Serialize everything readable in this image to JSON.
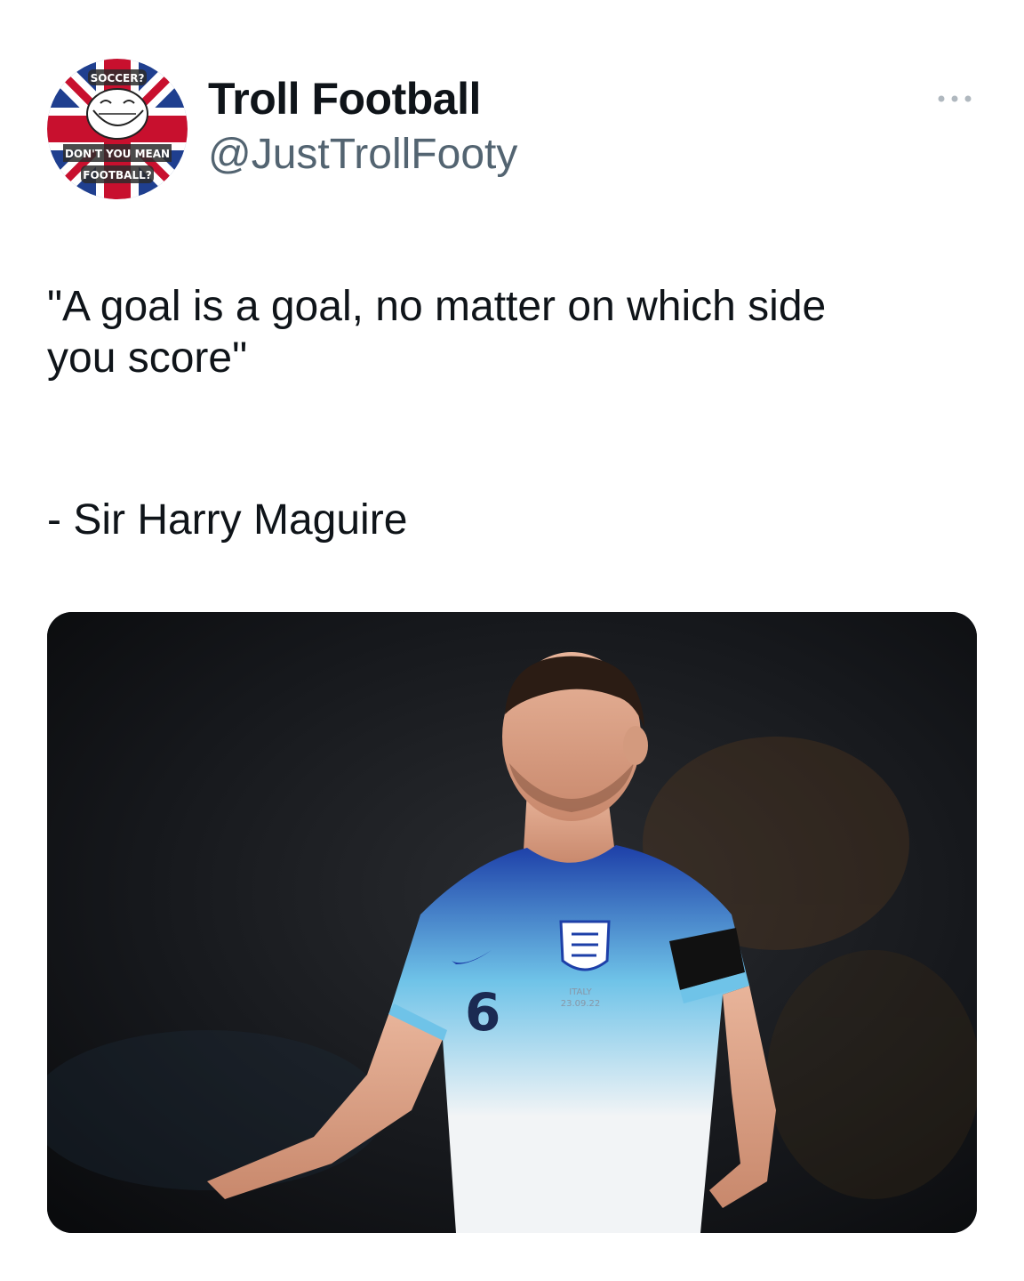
{
  "tweet": {
    "author": {
      "display_name": "Troll Football",
      "handle": "@JustTrollFooty",
      "avatar_icon": "troll-face-union-jack-badge",
      "avatar_text_top": "SOCCER?",
      "avatar_text_middle": "DON'T YOU MEAN",
      "avatar_text_bottom": "FOOTBALL?"
    },
    "more_icon": "more-horizontal-icon",
    "text_lines": [
      "\"A goal is a goal, no matter on which side",
      "you score\""
    ],
    "attribution": "- Sir Harry Maguire",
    "media": {
      "shirt_number": "6",
      "shirt_text_line1": "ITALY",
      "shirt_text_line2": "23.09.22"
    }
  },
  "colors": {
    "text_primary": "#0f1419",
    "text_secondary": "#536471",
    "background": "#ffffff"
  }
}
